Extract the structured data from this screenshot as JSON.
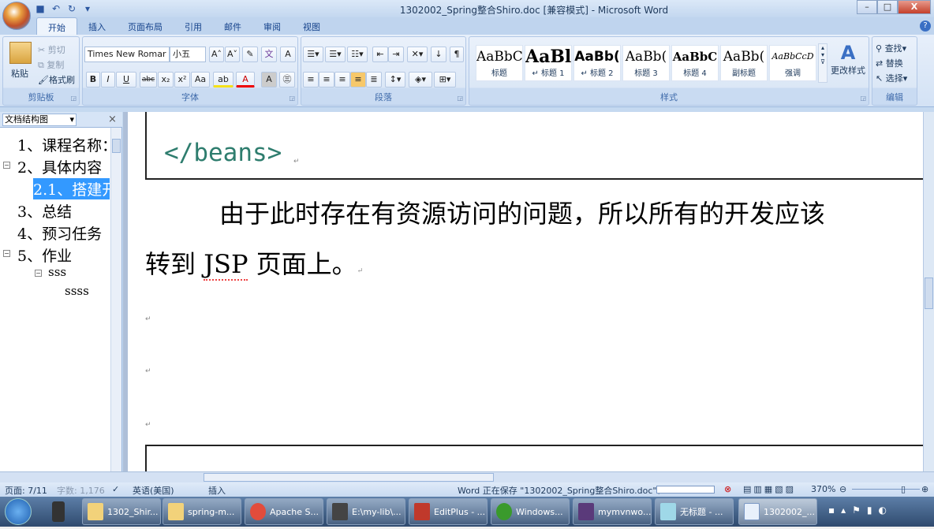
{
  "window": {
    "title": "1302002_Spring整合Shiro.doc [兼容模式] - Microsoft Word",
    "minimize": "–",
    "maximize": "□",
    "close": "X"
  },
  "ribbon": {
    "tabs": [
      {
        "label": "开始",
        "active": true
      },
      {
        "label": "插入"
      },
      {
        "label": "页面布局"
      },
      {
        "label": "引用"
      },
      {
        "label": "邮件"
      },
      {
        "label": "审阅"
      },
      {
        "label": "视图"
      }
    ],
    "clipboard": {
      "label": "剪贴板",
      "paste": "粘贴",
      "cut": "剪切",
      "copy": "复制",
      "format_painter": "格式刷"
    },
    "font": {
      "label": "字体",
      "font_name": "Times New Romar",
      "font_size": "小五",
      "bold": "B",
      "italic": "I",
      "underline": "U",
      "strike": "abc",
      "sub": "x₂",
      "sup": "x²",
      "case": "Aa",
      "grow": "A˄",
      "shrink": "A˅",
      "font_color": "A",
      "char_shade": "A",
      "enclose": "㊂"
    },
    "paragraph": {
      "label": "段落"
    },
    "styles": {
      "label": "样式",
      "items": [
        {
          "preview": "AaBbC",
          "name": "标题"
        },
        {
          "preview": "AaBl",
          "name": "↵ 标题 1"
        },
        {
          "preview": "AaBb(",
          "name": "↵ 标题 2"
        },
        {
          "preview": "AaBb(",
          "name": "标题 3"
        },
        {
          "preview": "AaBbC",
          "name": "标题 4"
        },
        {
          "preview": "AaBb(",
          "name": "副标题"
        },
        {
          "preview": "AaBbCcD",
          "name": "强调"
        }
      ],
      "change_styles": "更改样式"
    },
    "editing": {
      "label": "编辑",
      "find": "查找",
      "replace": "替换",
      "select": "选择"
    }
  },
  "nav": {
    "title": "文档结构图",
    "close": "×",
    "items": [
      {
        "label": "1、课程名称：",
        "expand": ""
      },
      {
        "label": "2、具体内容",
        "expand": "−"
      },
      {
        "label": "2.1、搭建开",
        "expand": "",
        "selected": true
      },
      {
        "label": "3、总结",
        "expand": ""
      },
      {
        "label": "4、预习任务",
        "expand": ""
      },
      {
        "label": "5、作业",
        "expand": "−"
      },
      {
        "label": "sss",
        "expand": "−"
      },
      {
        "label": "ssss",
        "expand": ""
      }
    ]
  },
  "document": {
    "code": "</beans>",
    "para_line1": "由于此时存在有资源访问的问题，所以所有的开发应该",
    "para_line2_pre": "转到 ",
    "para_line2_jsp": "JSP",
    "para_line2_post": " 页面上。",
    "mark": "↵",
    "code_color": "#2e7d6e"
  },
  "status": {
    "page": "页面: 7/11",
    "words": "字数: 1,176",
    "language": "英语(美国)",
    "mode": "插入",
    "saving": "Word 正在保存 \"1302002_Spring整合Shiro.doc\"：",
    "zoom": "370%"
  },
  "taskbar": {
    "items": [
      {
        "label": "1302_Shir...",
        "color": "#f2d27a"
      },
      {
        "label": "spring-m...",
        "color": "#f2d27a"
      },
      {
        "label": "Apache S...",
        "color": "#e24c3c"
      },
      {
        "label": "E:\\my-lib\\...",
        "color": "#444"
      },
      {
        "label": "EditPlus - ...",
        "color": "#c0392b"
      },
      {
        "label": "Windows...",
        "color": "#3a9a2c"
      },
      {
        "label": "mymvnwo...",
        "color": "#5a3a7a"
      },
      {
        "label": "无标题 - ...",
        "color": "#9fd8e8"
      },
      {
        "label": "1302002_...",
        "color": "#e8f0fb"
      }
    ]
  }
}
